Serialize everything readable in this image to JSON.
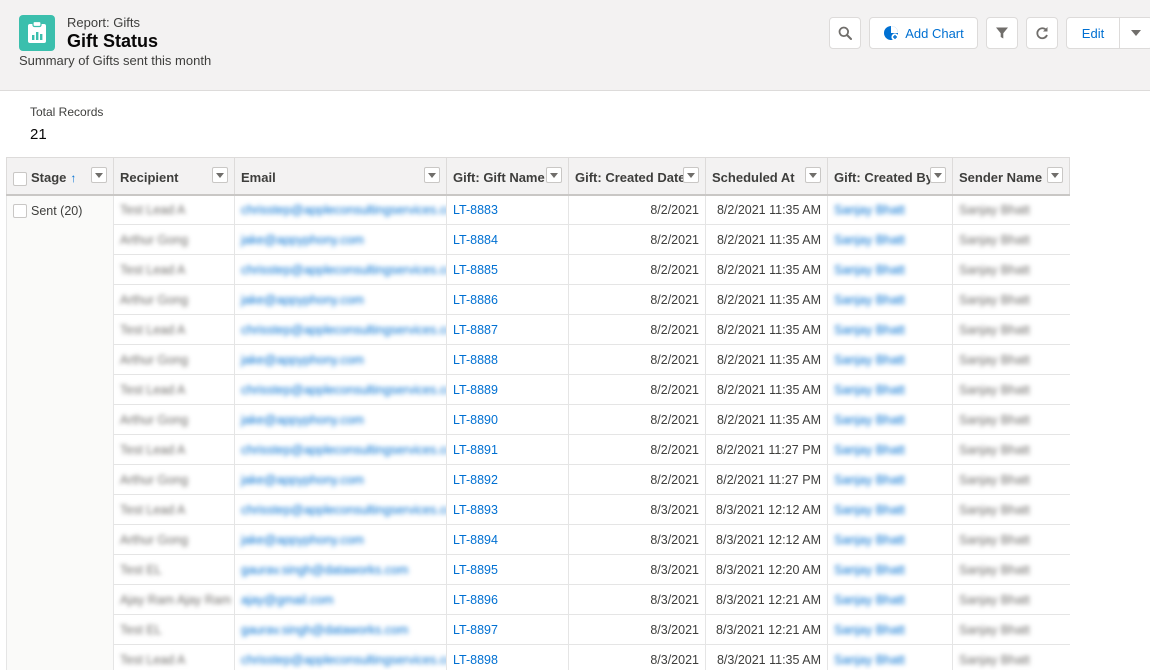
{
  "header": {
    "report_type": "Report: Gifts",
    "title": "Gift Status",
    "description": "Summary of Gifts sent this month",
    "add_chart_label": "Add Chart",
    "edit_label": "Edit"
  },
  "summary": {
    "total_label": "Total Records",
    "total_value": "21"
  },
  "table": {
    "columns": [
      "Stage",
      "Recipient",
      "Email",
      "Gift: Gift Name",
      "Gift: Created Date",
      "Scheduled At",
      "Gift: Created By",
      "Sender Name"
    ],
    "group_label": "Sent (20)",
    "rows": [
      {
        "recipient": "Test Lead A",
        "email": "chrisstep@appleconsultingservices.com",
        "gift": "LT-8883",
        "created": "8/2/2021",
        "scheduled": "8/2/2021 11:35 AM",
        "created_by": "Sanjay Bhatt",
        "sender": "Sanjay Bhatt"
      },
      {
        "recipient": "Arthur Gong",
        "email": "jake@appyphony.com",
        "gift": "LT-8884",
        "created": "8/2/2021",
        "scheduled": "8/2/2021 11:35 AM",
        "created_by": "Sanjay Bhatt",
        "sender": "Sanjay Bhatt"
      },
      {
        "recipient": "Test Lead A",
        "email": "chrisstep@appleconsultingservices.com",
        "gift": "LT-8885",
        "created": "8/2/2021",
        "scheduled": "8/2/2021 11:35 AM",
        "created_by": "Sanjay Bhatt",
        "sender": "Sanjay Bhatt"
      },
      {
        "recipient": "Arthur Gong",
        "email": "jake@appyphony.com",
        "gift": "LT-8886",
        "created": "8/2/2021",
        "scheduled": "8/2/2021 11:35 AM",
        "created_by": "Sanjay Bhatt",
        "sender": "Sanjay Bhatt"
      },
      {
        "recipient": "Test Lead A",
        "email": "chrisstep@appleconsultingservices.com",
        "gift": "LT-8887",
        "created": "8/2/2021",
        "scheduled": "8/2/2021 11:35 AM",
        "created_by": "Sanjay Bhatt",
        "sender": "Sanjay Bhatt"
      },
      {
        "recipient": "Arthur Gong",
        "email": "jake@appyphony.com",
        "gift": "LT-8888",
        "created": "8/2/2021",
        "scheduled": "8/2/2021 11:35 AM",
        "created_by": "Sanjay Bhatt",
        "sender": "Sanjay Bhatt"
      },
      {
        "recipient": "Test Lead A",
        "email": "chrisstep@appleconsultingservices.com",
        "gift": "LT-8889",
        "created": "8/2/2021",
        "scheduled": "8/2/2021 11:35 AM",
        "created_by": "Sanjay Bhatt",
        "sender": "Sanjay Bhatt"
      },
      {
        "recipient": "Arthur Gong",
        "email": "jake@appyphony.com",
        "gift": "LT-8890",
        "created": "8/2/2021",
        "scheduled": "8/2/2021 11:35 AM",
        "created_by": "Sanjay Bhatt",
        "sender": "Sanjay Bhatt"
      },
      {
        "recipient": "Test Lead A",
        "email": "chrisstep@appleconsultingservices.com",
        "gift": "LT-8891",
        "created": "8/2/2021",
        "scheduled": "8/2/2021 11:27 PM",
        "created_by": "Sanjay Bhatt",
        "sender": "Sanjay Bhatt"
      },
      {
        "recipient": "Arthur Gong",
        "email": "jake@appyphony.com",
        "gift": "LT-8892",
        "created": "8/2/2021",
        "scheduled": "8/2/2021 11:27 PM",
        "created_by": "Sanjay Bhatt",
        "sender": "Sanjay Bhatt"
      },
      {
        "recipient": "Test Lead A",
        "email": "chrisstep@appleconsultingservices.com",
        "gift": "LT-8893",
        "created": "8/3/2021",
        "scheduled": "8/3/2021 12:12 AM",
        "created_by": "Sanjay Bhatt",
        "sender": "Sanjay Bhatt"
      },
      {
        "recipient": "Arthur Gong",
        "email": "jake@appyphony.com",
        "gift": "LT-8894",
        "created": "8/3/2021",
        "scheduled": "8/3/2021 12:12 AM",
        "created_by": "Sanjay Bhatt",
        "sender": "Sanjay Bhatt"
      },
      {
        "recipient": "Test EL",
        "email": "gaurav.singh@dataworks.com",
        "gift": "LT-8895",
        "created": "8/3/2021",
        "scheduled": "8/3/2021 12:20 AM",
        "created_by": "Sanjay Bhatt",
        "sender": "Sanjay Bhatt"
      },
      {
        "recipient": "Ajay Ram Ajay Ram",
        "email": "ajay@gmail.com",
        "gift": "LT-8896",
        "created": "8/3/2021",
        "scheduled": "8/3/2021 12:21 AM",
        "created_by": "Sanjay Bhatt",
        "sender": "Sanjay Bhatt"
      },
      {
        "recipient": "Test EL",
        "email": "gaurav.singh@dataworks.com",
        "gift": "LT-8897",
        "created": "8/3/2021",
        "scheduled": "8/3/2021 12:21 AM",
        "created_by": "Sanjay Bhatt",
        "sender": "Sanjay Bhatt"
      },
      {
        "recipient": "Test Lead A",
        "email": "chrisstep@appleconsultingservices.com",
        "gift": "LT-8898",
        "created": "8/3/2021",
        "scheduled": "8/3/2021 11:35 AM",
        "created_by": "Sanjay Bhatt",
        "sender": "Sanjay Bhatt"
      }
    ]
  }
}
